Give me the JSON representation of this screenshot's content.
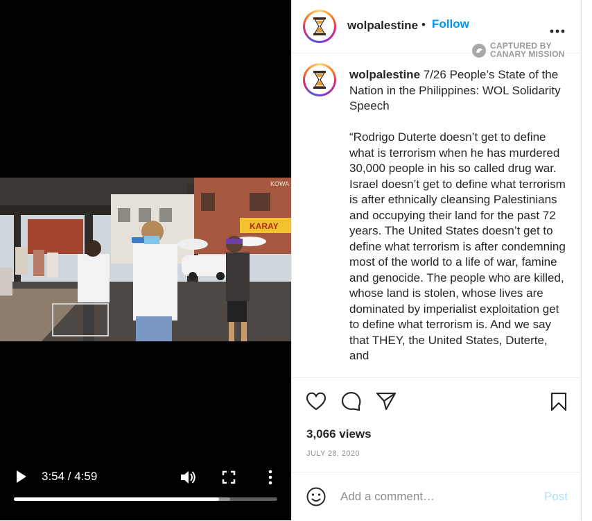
{
  "video": {
    "time": "3:54 / 4:59",
    "progress_fraction": 0.78,
    "buffer_fraction": 0.82,
    "controls": {
      "play_icon": "play-icon",
      "volume_icon": "volume-icon",
      "fullscreen_icon": "fullscreen-icon",
      "menu_icon": "vertical-dots-icon"
    },
    "scene_signs": {
      "store_sign": "KARAY",
      "store_sign_2": "KOWA"
    }
  },
  "post": {
    "username": "wolpalestine",
    "separator": "•",
    "follow_label": "Follow",
    "more_icon": "more-options-icon",
    "caption_title": " 7/26 People’s State of the Nation in the Philippines: WOL Solidarity Speech",
    "caption_body": "“Rodrigo Duterte doesn’t get to define what is terrorism when he has murdered 30,000 people in his so called drug war. Israel doesn’t get to define what terrorism is after ethnically cleansing Palestinians and occupying their land for the past 72 years. The United States doesn’t get to define what terrorism is after condemning most of the world to a life of war, famine and genocide. The people who are killed, whose land is stolen, whose lives are dominated by imperialist exploitation get to define what terrorism is. And we say that THEY, the United States, Duterte, and",
    "views": "3,066 views",
    "date": "JULY 28, 2020",
    "avatar_icon": "hourglass-logo-icon"
  },
  "watermark": {
    "line1": "CAPTURED BY",
    "line2": "CANARY MISSION"
  },
  "actions": {
    "like_icon": "heart-icon",
    "comment_icon": "comment-bubble-icon",
    "share_icon": "paper-plane-icon",
    "save_icon": "bookmark-icon"
  },
  "comment_box": {
    "placeholder": "Add a comment…",
    "post_label": "Post",
    "emoji_icon": "emoji-icon"
  },
  "colors": {
    "accent": "#0095f6",
    "post_disabled": "#b2dffc",
    "muted": "#8e8e8e"
  }
}
